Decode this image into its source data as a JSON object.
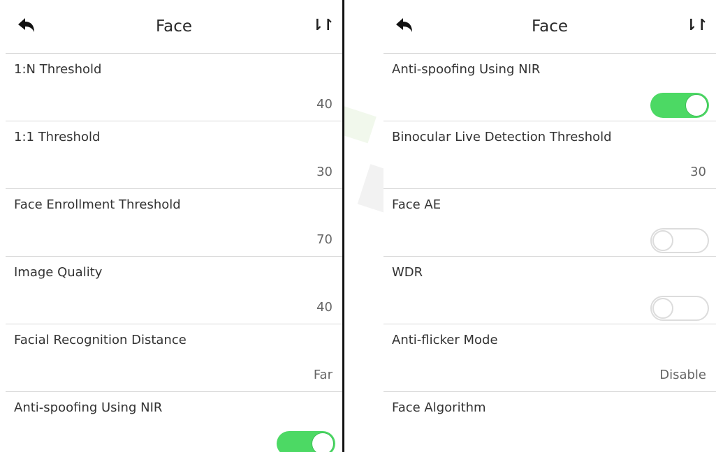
{
  "screens": [
    {
      "title": "Face",
      "rows": [
        {
          "label": "1:N Threshold",
          "value": "40"
        },
        {
          "label": "1:1 Threshold",
          "value": "30"
        },
        {
          "label": "Face Enrollment Threshold",
          "value": "70"
        },
        {
          "label": "Image Quality",
          "value": "40"
        },
        {
          "label": "Facial Recognition Distance",
          "value": "Far"
        },
        {
          "label": "Anti-spoofing Using NIR",
          "toggle": "on"
        }
      ]
    },
    {
      "title": "Face",
      "rows": [
        {
          "label": "Anti-spoofing Using NIR",
          "toggle": "on"
        },
        {
          "label": "Binocular Live Detection Threshold",
          "value": "30"
        },
        {
          "label": "Face AE",
          "toggle": "off"
        },
        {
          "label": "WDR",
          "toggle": "off"
        },
        {
          "label": "Anti-flicker Mode",
          "value": "Disable"
        },
        {
          "label": "Face Algorithm",
          "value": ""
        }
      ]
    }
  ],
  "icons": {
    "back": "back-arrow-icon",
    "sort": "sort-icon"
  },
  "colors": {
    "toggle_on": "#4cd964",
    "toggle_off_border": "#dcdcdc",
    "divider": "#d8d8d8"
  }
}
